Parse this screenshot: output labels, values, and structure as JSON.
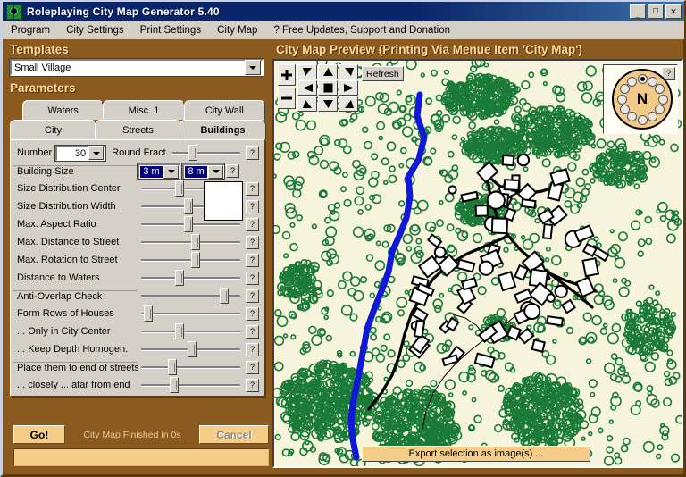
{
  "window": {
    "title": "Roleplaying City Map Generator 5.40",
    "icon": "globe-compass-icon",
    "minimize_label": "_",
    "maximize_label": "□",
    "close_label": "✕"
  },
  "menubar": {
    "items": [
      {
        "label": "Program",
        "name": "menu-program"
      },
      {
        "label": "City Settings",
        "name": "menu-city-settings"
      },
      {
        "label": "Print Settings",
        "name": "menu-print-settings"
      },
      {
        "label": "City Map",
        "name": "menu-city-map"
      },
      {
        "label": "? Free Updates, Support and Donation",
        "name": "menu-help-updates"
      }
    ]
  },
  "templates": {
    "heading": "Templates",
    "selected": "Small Village"
  },
  "parameters": {
    "heading": "Parameters",
    "tabs_row1": [
      {
        "label": "Waters",
        "active": false
      },
      {
        "label": "Misc. 1",
        "active": false
      },
      {
        "label": "City Wall",
        "active": false
      }
    ],
    "tabs_row2": [
      {
        "label": "City",
        "active": false
      },
      {
        "label": "Streets",
        "active": false
      },
      {
        "label": "Buildings",
        "active": true
      }
    ],
    "number_label": "Number",
    "number_value": "30",
    "round_fract_label": "Round Fract.",
    "round_fract_pos": 40,
    "building_size_label": "Building Size",
    "building_size_min": "3 m",
    "building_size_max": "8 m",
    "help_label": "?",
    "rows": [
      {
        "label": "Size Distribution Center",
        "slider": 38,
        "help": "?"
      },
      {
        "label": "Size Distribution Width",
        "slider": 48,
        "help": "?"
      },
      {
        "label": "Max. Aspect Ratio",
        "slider": 48,
        "help": "?"
      },
      {
        "label": "Max. Distance to Street",
        "slider": 56,
        "help": "?"
      },
      {
        "label": "Max. Rotation to Street",
        "slider": 56,
        "help": "?"
      },
      {
        "label": "Distance to Waters",
        "slider": 38,
        "help": "?"
      },
      {
        "label": "Anti-Overlap Check",
        "slider": 88,
        "help": "?"
      },
      {
        "label": "Form Rows of Houses",
        "slider": 3,
        "help": "?"
      },
      {
        "label": "... Only in City Center",
        "slider": 38,
        "help": "?"
      },
      {
        "label": "... Keep Depth Homogen.",
        "slider": 52,
        "help": "?"
      },
      {
        "label": "Place them to end of streets",
        "slider": 30,
        "help": "?"
      },
      {
        "label": "... closely ... afar from end",
        "slider": 32,
        "help": "?"
      }
    ],
    "color_swatch": "#ffffff"
  },
  "actions": {
    "go_label": "Go!",
    "status": "City Map Finished in 0s",
    "cancel_label": "Cancel"
  },
  "preview": {
    "heading": "City Map Preview (Printing Via Menue Item 'City Map')",
    "zoom_in": "+",
    "zoom_out": "−",
    "refresh_label": "Refresh",
    "pad": [
      {
        "name": "pan-northwest",
        "dir": "nw"
      },
      {
        "name": "pan-north",
        "dir": "n"
      },
      {
        "name": "pan-northeast",
        "dir": "ne"
      },
      {
        "name": "pan-west",
        "dir": "w"
      },
      {
        "name": "pan-center",
        "dir": "c"
      },
      {
        "name": "pan-east",
        "dir": "e"
      },
      {
        "name": "pan-southwest",
        "dir": "sw"
      },
      {
        "name": "pan-south",
        "dir": "s"
      },
      {
        "name": "pan-southeast",
        "dir": "se"
      }
    ],
    "compass": {
      "center_label": "N",
      "help_label": "?",
      "positions": 12,
      "selected_index": 0
    },
    "export_label": "Export selection as image(s) ...",
    "colors": {
      "map_background": "#f7f4dd",
      "forest": "#1a7a38",
      "river": "#1018d8",
      "road": "#000000",
      "building": "#000000"
    }
  }
}
